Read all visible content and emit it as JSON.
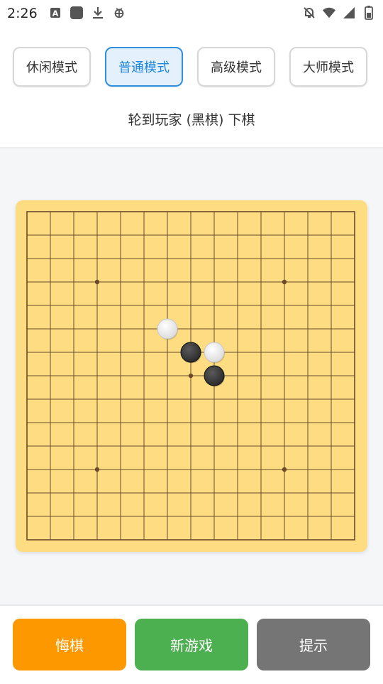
{
  "status_bar": {
    "time": "2:26",
    "left_icons": [
      "font-a-icon",
      "square-app-icon",
      "download-icon",
      "bug-icon"
    ],
    "right_icons": [
      "bell-off-icon",
      "wifi-icon",
      "signal-icon",
      "battery-icon"
    ]
  },
  "modes": [
    {
      "label": "休闲模式",
      "active": false
    },
    {
      "label": "普通模式",
      "active": true
    },
    {
      "label": "高级模式",
      "active": false
    },
    {
      "label": "大师模式",
      "active": false
    }
  ],
  "turn_text": "轮到玩家 (黑棋) 下棋",
  "board": {
    "size": 15,
    "star_points": [
      [
        3,
        3
      ],
      [
        11,
        3
      ],
      [
        7,
        7
      ],
      [
        3,
        11
      ],
      [
        11,
        11
      ]
    ],
    "stones": [
      {
        "col": 6,
        "row": 5,
        "color": "white"
      },
      {
        "col": 7,
        "row": 6,
        "color": "black"
      },
      {
        "col": 8,
        "row": 6,
        "color": "white"
      },
      {
        "col": 8,
        "row": 7,
        "color": "black"
      }
    ],
    "colors": {
      "wood": "#fedd82",
      "line": "#6b4a2a",
      "black_stone": "#2b2b2b",
      "white_stone": "#f4f4f4"
    }
  },
  "actions": {
    "undo_label": "悔棋",
    "new_game_label": "新游戏",
    "hint_label": "提示"
  },
  "colors": {
    "undo": "#fe9800",
    "new_game": "#4caf50",
    "hint": "#757575",
    "active_mode": "#2f8fde"
  }
}
